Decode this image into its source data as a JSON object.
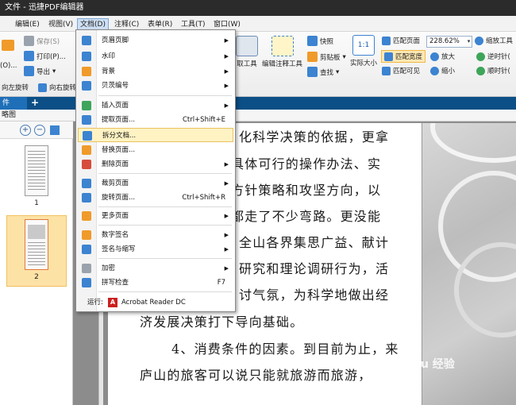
{
  "window": {
    "title": "文件 - 迅捷PDF编辑器"
  },
  "menubar": {
    "items": [
      "编辑(E)",
      "视图(V)",
      "文档(D)",
      "注释(C)",
      "表单(R)",
      "工具(T)",
      "窗口(W)"
    ]
  },
  "ribbon": {
    "save": "保存(S)",
    "open": "(O)...",
    "print": "打印(P)...",
    "export": "导出",
    "rotate_left": "向左旋转",
    "rotate_right": "向右旋转",
    "snapshot": "快照",
    "clipboard": "剪贴板",
    "find": "查找",
    "select_tool": "取工具",
    "edit_annot_tool": "编辑注释工具",
    "actual_size": "实际大小",
    "fit_page": "匹配页面",
    "fit_width": "匹配宽度",
    "fit_visible": "匹配可见",
    "zoom_value": "228.62%",
    "zoom_in": "放大",
    "zoom_out": "缩小",
    "zoom_tool": "缩放工具",
    "rotate_ccw": "逆时针(",
    "rotate_cw": "顺时针("
  },
  "tabs": {
    "active": "件",
    "add": "+"
  },
  "sidebar": {
    "title": "略图",
    "pages": [
      "1",
      "2"
    ]
  },
  "document_menu": {
    "items": [
      {
        "label": "页眉页脚",
        "shortcut": "",
        "submenu": true
      },
      {
        "label": "水印",
        "shortcut": "",
        "submenu": true
      },
      {
        "label": "背景",
        "shortcut": "",
        "submenu": true
      },
      {
        "label": "贝茨编号",
        "shortcut": "",
        "submenu": true
      },
      {
        "label": "插入页面",
        "shortcut": "",
        "submenu": true
      },
      {
        "label": "提取页面...",
        "shortcut": "Ctrl+Shift+E",
        "submenu": false
      },
      {
        "label": "拆分文档...",
        "shortcut": "",
        "submenu": false
      },
      {
        "label": "替换页面...",
        "shortcut": "",
        "submenu": false
      },
      {
        "label": "删除页面",
        "shortcut": "",
        "submenu": true
      },
      {
        "label": "裁剪页面",
        "shortcut": "",
        "submenu": true
      },
      {
        "label": "旋转页面...",
        "shortcut": "Ctrl+Shift+R",
        "submenu": false
      },
      {
        "label": "更多页面",
        "shortcut": "",
        "submenu": true
      },
      {
        "label": "数字签名",
        "shortcut": "",
        "submenu": true
      },
      {
        "label": "签名与缩写",
        "shortcut": "",
        "submenu": true
      },
      {
        "label": "加密",
        "shortcut": "",
        "submenu": true
      },
      {
        "label": "拼写检查",
        "shortcut": "F7",
        "submenu": false
      }
    ],
    "run_prefix": "运行:",
    "run_app": "Acrobat Reader DC"
  },
  "document": {
    "lines": [
      "化科学决策的依据，更拿",
      "具体可行的操作办法、实",
      "方针策略和攻坚方向，以",
      "都走了不少弯路。更没能",
      "全山各界集思广益、献计",
      "研究和理论调研行为，活",
      "讨气氛，为科学地做出经",
      "济发展决策打下导向基础。",
      "4、消费条件的因素。到目前为止，来",
      "庐山的旅客可以说只能就旅游而旅游，"
    ]
  },
  "watermark": "Baidu 经验"
}
